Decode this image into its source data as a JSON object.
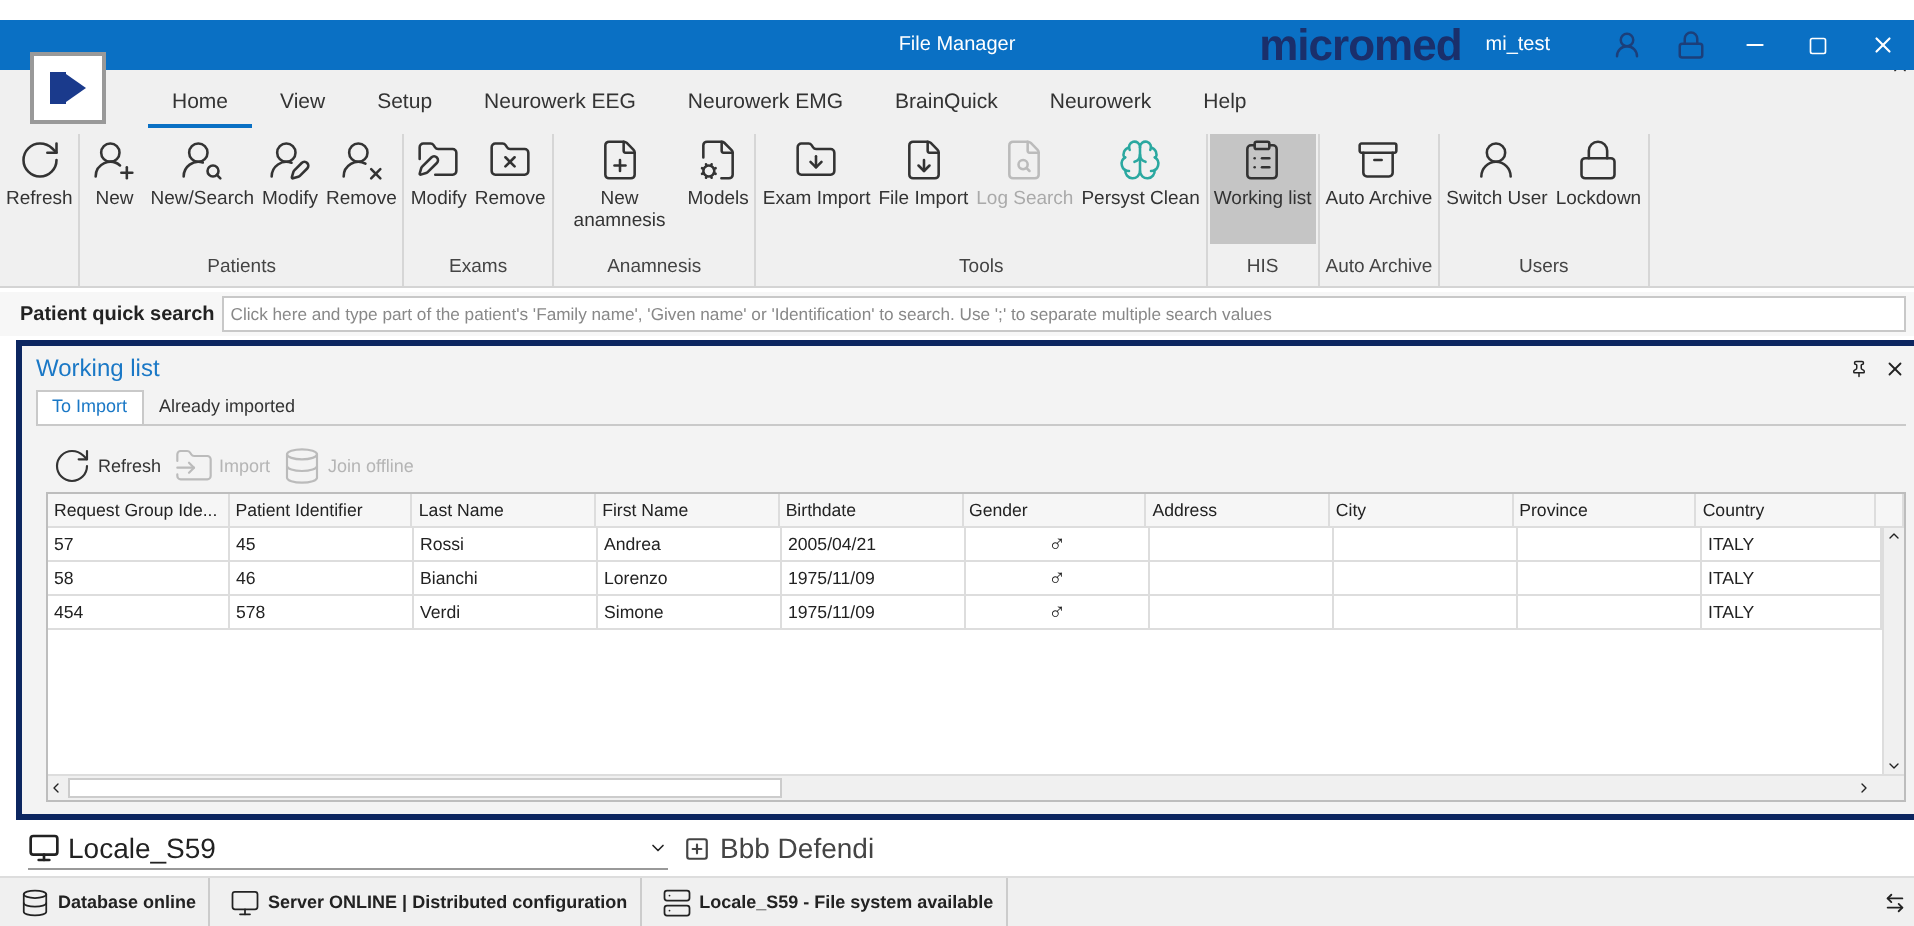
{
  "window": {
    "title": "File Manager",
    "brand": "micromed",
    "user": "mi_test"
  },
  "ribbon_tabs": [
    {
      "label": "Home",
      "selected": true
    },
    {
      "label": "View",
      "selected": false
    },
    {
      "label": "Setup",
      "selected": false
    },
    {
      "label": "Neurowerk EEG",
      "selected": false
    },
    {
      "label": "Neurowerk EMG",
      "selected": false
    },
    {
      "label": "BrainQuick",
      "selected": false
    },
    {
      "label": "Neurowerk",
      "selected": false
    },
    {
      "label": "Help",
      "selected": false
    }
  ],
  "ribbon_groups": [
    {
      "buttons": [
        {
          "label": "Refresh",
          "disabled": false,
          "selected": false
        }
      ]
    },
    {
      "label": "Patients",
      "buttons": [
        {
          "label": "New",
          "disabled": false,
          "selected": false
        },
        {
          "label": "New/Search",
          "disabled": false,
          "selected": false
        },
        {
          "label": "Modify",
          "disabled": false,
          "selected": false
        },
        {
          "label": "Remove",
          "disabled": false,
          "selected": false
        }
      ]
    },
    {
      "label": "Exams",
      "buttons": [
        {
          "label": "Modify",
          "disabled": false,
          "selected": false
        },
        {
          "label": "Remove",
          "disabled": false,
          "selected": false
        }
      ]
    },
    {
      "label": "Anamnesis",
      "buttons": [
        {
          "label": "New anamnesis",
          "disabled": false,
          "selected": false
        },
        {
          "label": "Models",
          "disabled": false,
          "selected": false
        }
      ]
    },
    {
      "label": "Tools",
      "buttons": [
        {
          "label": "Exam Import",
          "disabled": false,
          "selected": false
        },
        {
          "label": "File Import",
          "disabled": false,
          "selected": false
        },
        {
          "label": "Log Search",
          "disabled": true,
          "selected": false
        },
        {
          "label": "Persyst Clean",
          "disabled": false,
          "selected": false
        }
      ]
    },
    {
      "label": "HIS",
      "buttons": [
        {
          "label": "Working list",
          "disabled": false,
          "selected": true
        }
      ]
    },
    {
      "label": "Auto Archive",
      "buttons": [
        {
          "label": "Auto Archive",
          "disabled": false,
          "selected": false
        }
      ]
    },
    {
      "label": "Users",
      "buttons": [
        {
          "label": "Switch User",
          "disabled": false,
          "selected": false
        },
        {
          "label": "Lockdown",
          "disabled": false,
          "selected": false
        }
      ]
    }
  ],
  "quick_search": {
    "label": "Patient quick search",
    "placeholder": "Click here and type part of the patient's 'Family name', 'Given name' or 'Identification' to search. Use ';' to separate multiple search values"
  },
  "working_list": {
    "title": "Working list",
    "tabs": [
      {
        "label": "To Import",
        "selected": true
      },
      {
        "label": "Already imported",
        "selected": false
      }
    ],
    "toolbar": [
      {
        "label": "Refresh",
        "disabled": false
      },
      {
        "label": "Import",
        "disabled": true
      },
      {
        "label": "Join offline",
        "disabled": true
      }
    ],
    "table": {
      "columns": [
        "Request Group Ide...",
        "Patient Identifier",
        "Last Name",
        "First Name",
        "Birthdate",
        "Gender",
        "Address",
        "City",
        "Province",
        "Country"
      ],
      "rows": [
        [
          "57",
          "45",
          "Rossi",
          "Andrea",
          "2005/04/21",
          "♂",
          "",
          "",
          "",
          "ITALY"
        ],
        [
          "58",
          "46",
          "Bianchi",
          "Lorenzo",
          "1975/11/09",
          "♂",
          "",
          "",
          "",
          "ITALY"
        ],
        [
          "454",
          "578",
          "Verdi",
          "Simone",
          "1975/11/09",
          "♂",
          "",
          "",
          "",
          "ITALY"
        ]
      ]
    }
  },
  "location": {
    "station": "Locale_S59",
    "node": "Bbb Defendi"
  },
  "status_bar": [
    "Database online",
    "Server ONLINE | Distributed configuration",
    "Locale_S59 - File system available"
  ]
}
